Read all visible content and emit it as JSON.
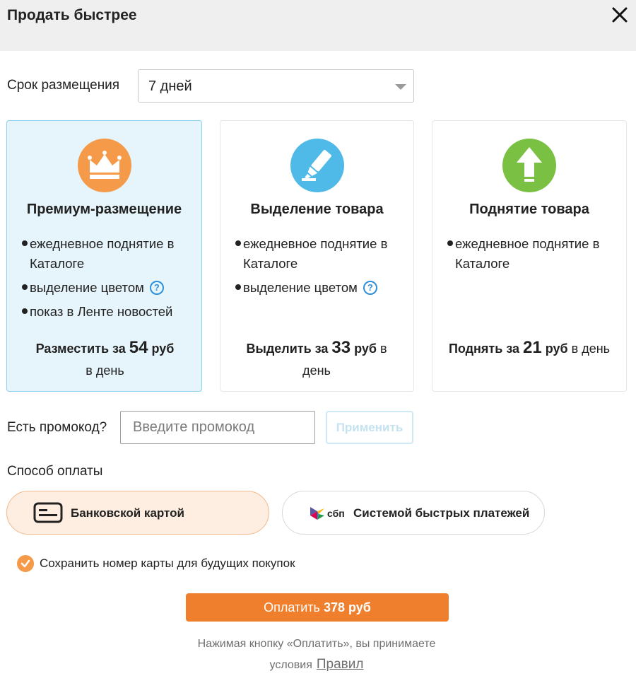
{
  "header": {
    "title": "Продать быстрее"
  },
  "term": {
    "label": "Срок размещения",
    "value": "7 дней"
  },
  "cards": [
    {
      "title": "Премиум-размещение",
      "icon": "crown-icon",
      "color": "#f49a48",
      "selected": true,
      "features": [
        "ежедневное поднятие в Каталоге",
        "выделение цветом",
        "показ в Ленте новостей"
      ],
      "price_prefix": "Разместить за",
      "price": "54",
      "price_unit": "руб",
      "price_suffix": "в день"
    },
    {
      "title": "Выделение товара",
      "icon": "highlighter-icon",
      "color": "#4fb9e8",
      "selected": false,
      "features": [
        "ежедневное поднятие в Каталоге",
        "выделение цветом"
      ],
      "price_prefix": "Выделить за",
      "price": "33",
      "price_unit": "руб",
      "price_suffix": "в день"
    },
    {
      "title": "Поднятие товара",
      "icon": "arrow-up-icon",
      "color": "#7ac143",
      "selected": false,
      "features": [
        "ежедневное поднятие в Каталоге"
      ],
      "price_prefix": "Поднять за",
      "price": "21",
      "price_unit": "руб",
      "price_suffix": "в день"
    }
  ],
  "promo": {
    "label": "Есть промокод?",
    "placeholder": "Введите промокод",
    "apply_label": "Применить"
  },
  "payment": {
    "label": "Способ оплаты",
    "options": [
      {
        "label": "Банковской картой",
        "icon": "card-icon",
        "selected": true
      },
      {
        "label": "Системой быстрых платежей",
        "icon": "sbp-logo-icon",
        "logo_text": "сбп",
        "selected": false
      }
    ]
  },
  "save_card": {
    "label": "Сохранить номер карты для будущих покупок",
    "checked": true
  },
  "pay_button": {
    "prefix": "Оплатить",
    "amount": "378 руб"
  },
  "terms": {
    "line1": "Нажимая кнопку «Оплатить», вы принимаете",
    "line2_prefix": "условия",
    "link": "Правил"
  }
}
